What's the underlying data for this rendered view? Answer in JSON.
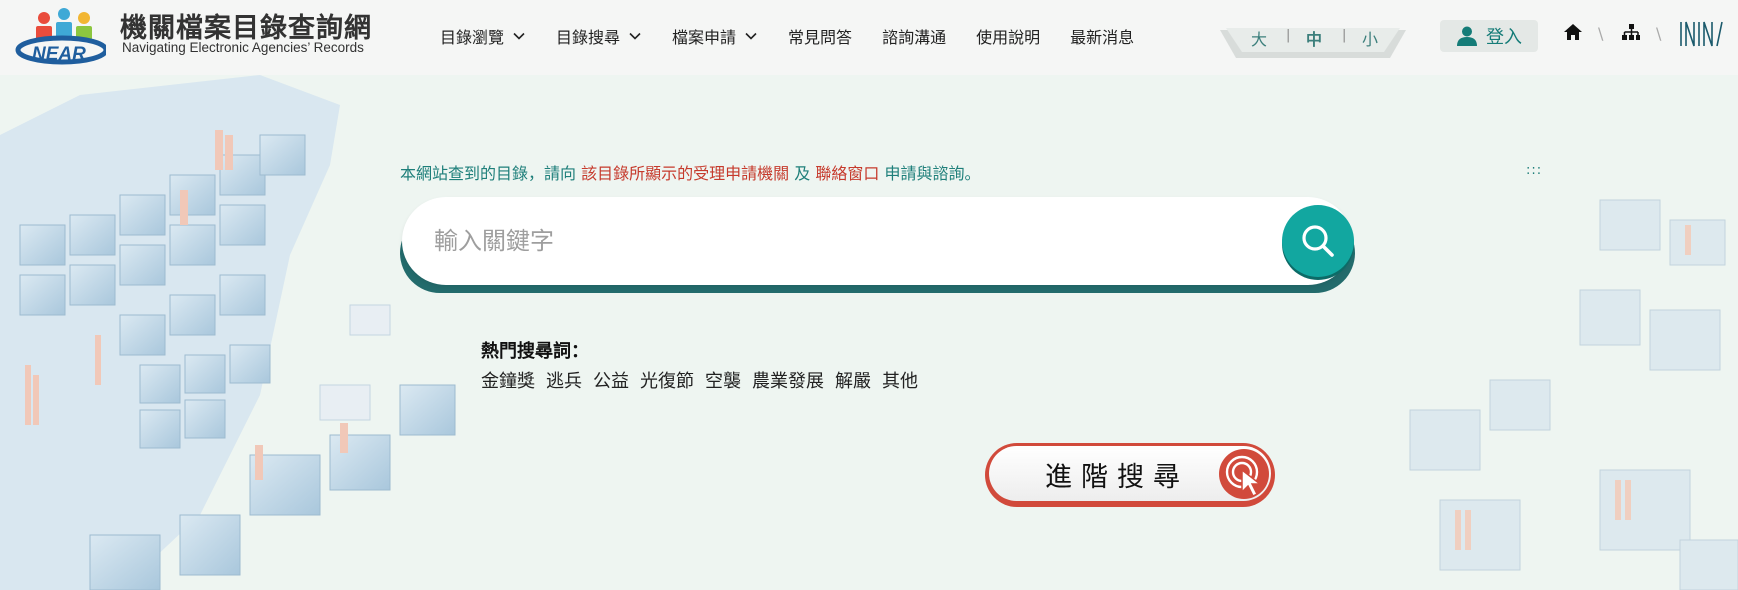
{
  "brand": {
    "logo_text": "NEAR",
    "title": "機關檔案目錄查詢網",
    "subtitle": "Navigating Electronic Agencies’ Records"
  },
  "nav": {
    "items": [
      {
        "label": "目錄瀏覽",
        "has_dropdown": true
      },
      {
        "label": "目錄搜尋",
        "has_dropdown": true
      },
      {
        "label": "檔案申請",
        "has_dropdown": true
      },
      {
        "label": "常見問答",
        "has_dropdown": false
      },
      {
        "label": "諮詢溝通",
        "has_dropdown": false
      },
      {
        "label": "使用說明",
        "has_dropdown": false
      },
      {
        "label": "最新消息",
        "has_dropdown": false
      }
    ]
  },
  "font_size": {
    "large": "大",
    "medium": "中",
    "small": "小",
    "selected": "中"
  },
  "login": {
    "label": "登入"
  },
  "header_icons": [
    "home-icon",
    "sitemap-icon",
    "archives-logo-icon"
  ],
  "notice": {
    "part1": "本網站查到的目錄，請向",
    "highlight1": "該目錄所顯示的受理申請機關",
    "part2": "及",
    "highlight2": "聯絡窗口",
    "part3": "申請與諮詢。"
  },
  "accesskey": ":::",
  "search": {
    "placeholder": "輸入關鍵字",
    "value": ""
  },
  "hot_keywords": {
    "title": "熱門搜尋詞：",
    "items": [
      "金鐘獎",
      "逃兵",
      "公益",
      "光復節",
      "空襲",
      "農業發展",
      "解嚴",
      "其他"
    ]
  },
  "advanced_search": {
    "label": "進階搜尋"
  },
  "colors": {
    "accent": "#12a7a0",
    "highlight": "#c63a2c",
    "teal_text": "#1e7f7a",
    "background": "#eef5f1"
  }
}
